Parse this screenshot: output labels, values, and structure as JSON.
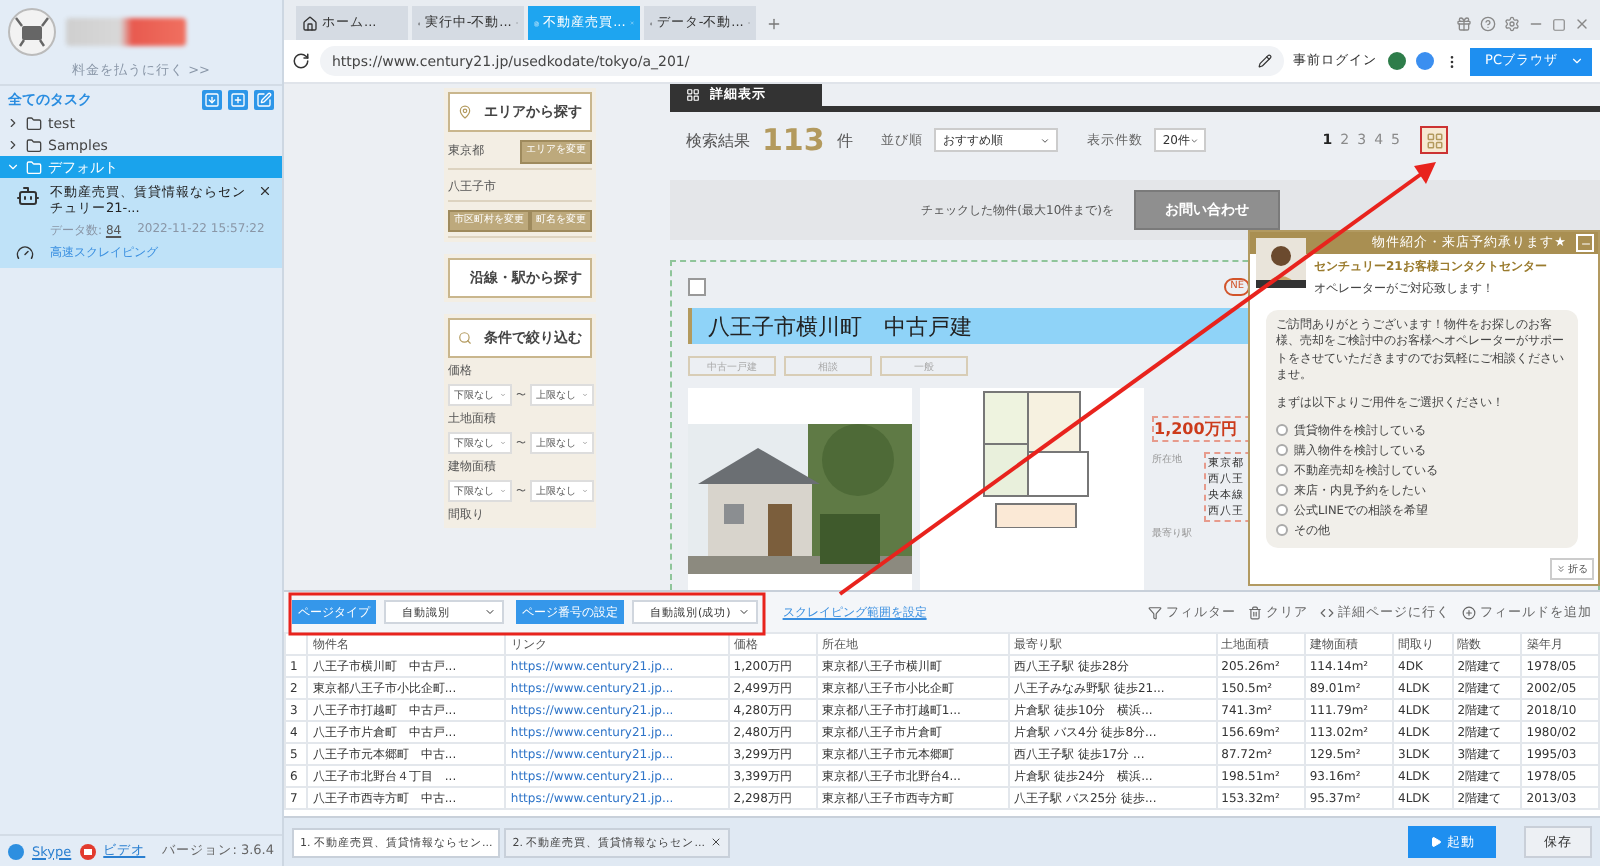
{
  "sidebar": {
    "billing_link": "料金を払うに行く >>",
    "all_tasks": "全てのタスク",
    "folders": [
      {
        "name": "test",
        "expanded": false,
        "selected": false
      },
      {
        "name": "Samples",
        "expanded": false,
        "selected": false
      },
      {
        "name": "デフォルト",
        "expanded": true,
        "selected": true,
        "tasks": [
          {
            "title": "不動産売買、賃貸情報ならセンチュリー21-...",
            "data_label": "データ数:",
            "count": "84",
            "date": "2022-11-22 15:57:22",
            "mode": "高速スクレイピング"
          }
        ]
      }
    ],
    "footer": {
      "skype": "Skype",
      "video": "ビデオ",
      "version": "バージョン: 3.6.4"
    }
  },
  "browser_tabs": [
    {
      "label": "ホーム...",
      "kind": "home",
      "selected": false
    },
    {
      "label": "実行中-不動...",
      "kind": "page",
      "selected": false
    },
    {
      "label": "不動産売買...",
      "kind": "page",
      "selected": true
    },
    {
      "label": "データ-不動...",
      "kind": "page",
      "selected": false
    }
  ],
  "address_bar": {
    "url": "https://www.century21.jp/usedkodate/tokyo/a_201/",
    "login": "事前ログイン",
    "browser_button": "PCブラウザ"
  },
  "web_page": {
    "area_search": {
      "title": "エリアから探す",
      "prefecture": "東京都",
      "change_area": "エリアを変更",
      "city": "八王子市",
      "buttons": [
        "市区町村を変更",
        "町名を変更"
      ]
    },
    "line_search": {
      "title": "沿線・駅から探す"
    },
    "filter_search": {
      "title": "条件で絞り込む",
      "filters": [
        {
          "label": "価格",
          "min": "下限なし",
          "sep": "〜",
          "max": "上限なし"
        },
        {
          "label": "土地面積",
          "min": "下限なし",
          "sep": "〜",
          "max": "上限なし"
        },
        {
          "label": "建物面積",
          "min": "下限なし",
          "sep": "〜",
          "max": "上限なし"
        }
      ],
      "last_label": "間取り"
    },
    "view_tab": "詳細表示",
    "results": {
      "label": "検索結果",
      "count": "113",
      "unit": "件",
      "sort_label": "並び順",
      "sort_value": "おすすめ順",
      "per_page_label": "表示件数",
      "per_page_value": "20件"
    },
    "pages": [
      {
        "label": "1",
        "selected": true
      },
      {
        "label": "2",
        "selected": false
      },
      {
        "label": "3",
        "selected": false
      },
      {
        "label": "4",
        "selected": false
      },
      {
        "label": "5",
        "selected": false
      }
    ],
    "inquiry": {
      "text": "チェックした物件(最大10件まで)を",
      "button": "お問い合わせ"
    },
    "listing": {
      "checked": false,
      "badge": "NE",
      "title": "八王子市横川町　中古戸建",
      "tags": [
        "中古一戸建",
        "相談",
        "一般"
      ],
      "price": "1,200万円",
      "labels": [
        "所在地",
        "最寄り駅"
      ],
      "values": [
        "東京都",
        "西八王",
        "央本線",
        "西八王"
      ]
    }
  },
  "chat": {
    "header": "物件紹介・来店予約承ります★",
    "org": "センチュリー21お客様コンタクトセンター",
    "sub": "オペレーターがご対応致します！",
    "message": "ご訪問ありがとうございます！物件をお探しのお客様、売却をご検討中のお客様へオペレーターがサポートをさせていただきますのでお気軽にご相談くださいませ。",
    "prompt": "まずは以下よりご用件をご選択ください！",
    "options": [
      {
        "label": "賃貸物件を検討している",
        "selected": false
      },
      {
        "label": "購入物件を検討している",
        "selected": false
      },
      {
        "label": "不動産売却を検討している",
        "selected": false
      },
      {
        "label": "来店・内見予約をしたい",
        "selected": false
      },
      {
        "label": "公式LINEでの相談を希望",
        "selected": false
      },
      {
        "label": "その他",
        "selected": false
      }
    ],
    "collapse": "折る"
  },
  "data_panel": {
    "page_type_label": "ページタイプ",
    "page_type_value": "自動識別",
    "page_number_label": "ページ番号の設定",
    "page_number_value": "自動識別(成功)",
    "range_link": "スクレイピング範囲を設定",
    "actions": [
      {
        "label": "フィルター",
        "kind": "filter"
      },
      {
        "label": "クリア",
        "kind": "clear"
      },
      {
        "label": "詳細ページに行く",
        "kind": "detail"
      },
      {
        "label": "フィールドを追加",
        "kind": "add"
      }
    ],
    "columns": [
      "",
      "物件名",
      "リンク",
      "価格",
      "所在地",
      "最寄り駅",
      "土地面積",
      "建物面積",
      "間取り",
      "階数",
      "築年月"
    ],
    "rows": [
      [
        "1",
        "八王子市横川町　中古戸...",
        "https://www.century21.jp...",
        "1,200万円",
        "東京都八王子市横川町",
        "西八王子駅 徒歩28分",
        "205.26m²",
        "114.14m²",
        "4DK",
        "2階建て",
        "1978/05"
      ],
      [
        "2",
        "東京都八王子市小比企町...",
        "https://www.century21.jp...",
        "2,499万円",
        "東京都八王子市小比企町",
        "八王子みなみ野駅 徒歩21...",
        "150.5m²",
        "89.01m²",
        "4LDK",
        "2階建て",
        "2002/05"
      ],
      [
        "3",
        "八王子市打越町　中古戸...",
        "https://www.century21.jp...",
        "4,280万円",
        "東京都八王子市打越町1...",
        "片倉駅 徒歩10分　横浜...",
        "741.3m²",
        "111.79m²",
        "4LDK",
        "2階建て",
        "2018/10"
      ],
      [
        "4",
        "八王子市片倉町　中古戸...",
        "https://www.century21.jp...",
        "2,480万円",
        "東京都八王子市片倉町",
        "片倉駅 バス4分 徒歩8分...",
        "156.69m²",
        "113.02m²",
        "4LDK",
        "2階建て",
        "1980/02"
      ],
      [
        "5",
        "八王子市元本郷町　中古...",
        "https://www.century21.jp...",
        "3,299万円",
        "東京都八王子市元本郷町",
        "西八王子駅 徒歩17分 ...",
        "87.72m²",
        "129.5m²",
        "3LDK",
        "3階建て",
        "1995/03"
      ],
      [
        "6",
        "八王子市北野台４丁目　...",
        "https://www.century21.jp...",
        "3,399万円",
        "東京都八王子市北野台4...",
        "片倉駅 徒歩24分　横浜...",
        "198.51m²",
        "93.16m²",
        "4LDK",
        "2階建て",
        "1978/05"
      ],
      [
        "7",
        "八王子市西寺方町　中古...",
        "https://www.century21.jp...",
        "2,298万円",
        "東京都八王子市西寺方町",
        "八王子駅 バス25分 徒歩...",
        "153.32m²",
        "95.37m²",
        "4LDK",
        "2階建て",
        "2013/03"
      ]
    ]
  },
  "task_tabs": [
    {
      "label": "1. 不動産売買、賃貸情報ならセン...",
      "selected": true
    },
    {
      "label": "2. 不動産売買、賃貸情報ならセン...",
      "selected": false
    }
  ],
  "run_button": "起動",
  "save_button": "保存"
}
